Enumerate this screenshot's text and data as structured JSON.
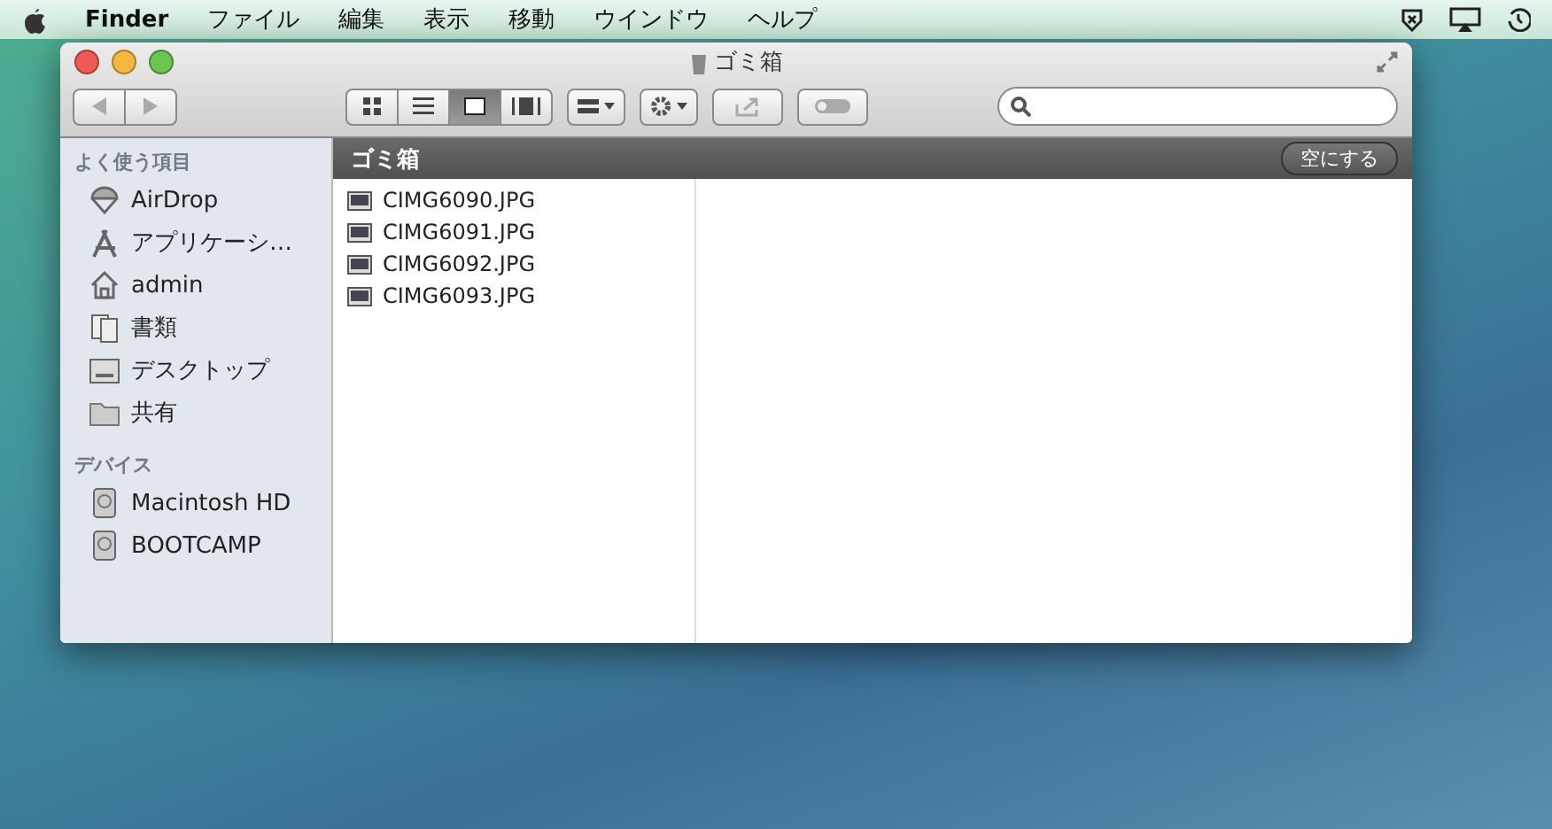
{
  "menu_bar": {
    "app": "Finder",
    "items": [
      "ファイル",
      "編集",
      "表示",
      "移動",
      "ウインドウ",
      "ヘルプ"
    ]
  },
  "window": {
    "title": "ゴミ箱"
  },
  "toolbar": {
    "view_buttons": [
      {
        "kind": "icon",
        "selected": false
      },
      {
        "kind": "list",
        "selected": false
      },
      {
        "kind": "columns",
        "selected": true
      },
      {
        "kind": "coverflow",
        "selected": false
      }
    ]
  },
  "sidebar": {
    "sections": [
      {
        "heading": "よく使う項目",
        "items": [
          {
            "label": "AirDrop",
            "kind": "airdrop"
          },
          {
            "label": "アプリケーシ…",
            "kind": "apps"
          },
          {
            "label": "admin",
            "kind": "home"
          },
          {
            "label": "書類",
            "kind": "docs"
          },
          {
            "label": "デスクトップ",
            "kind": "desktop"
          },
          {
            "label": "共有",
            "kind": "folder"
          }
        ]
      },
      {
        "heading": "デバイス",
        "items": [
          {
            "label": "Macintosh HD",
            "kind": "disk"
          },
          {
            "label": "BOOTCAMP",
            "kind": "disk"
          }
        ]
      }
    ]
  },
  "path_bar": {
    "title": "ゴミ箱",
    "empty_button": "空にする"
  },
  "files": [
    "CIMG6090.JPG",
    "CIMG6091.JPG",
    "CIMG6092.JPG",
    "CIMG6093.JPG"
  ]
}
